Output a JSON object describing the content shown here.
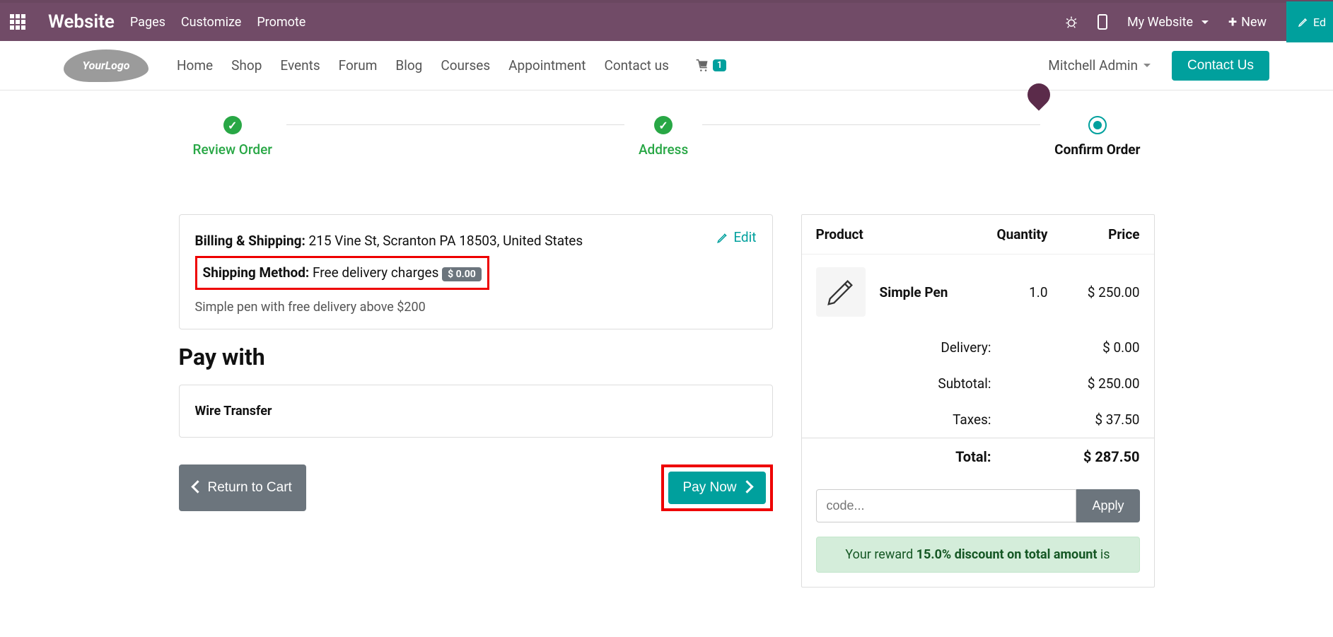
{
  "topbar": {
    "brand": "Website",
    "menu": [
      "Pages",
      "Customize",
      "Promote"
    ],
    "mywebsite": "My Website",
    "new": "New",
    "edit": "Ed"
  },
  "sitebar": {
    "logo_text": "YourLogo",
    "nav": [
      "Home",
      "Shop",
      "Events",
      "Forum",
      "Blog",
      "Courses",
      "Appointment",
      "Contact us"
    ],
    "cart_count": "1",
    "user": "Mitchell Admin",
    "contact": "Contact Us"
  },
  "steps": {
    "review": "Review Order",
    "address": "Address",
    "confirm": "Confirm Order"
  },
  "shipping_card": {
    "billing_label": "Billing & Shipping:",
    "billing_value": "215 Vine St, Scranton PA 18503, United States",
    "edit": "Edit",
    "method_label": "Shipping Method:",
    "method_value": "Free delivery charges",
    "method_price": "$ 0.00",
    "note": "Simple pen with free delivery above $200"
  },
  "pay": {
    "title": "Pay with",
    "method": "Wire Transfer",
    "return": "Return to Cart",
    "paynow": "Pay Now"
  },
  "summary": {
    "headers": {
      "product": "Product",
      "qty": "Quantity",
      "price": "Price"
    },
    "item": {
      "name": "Simple Pen",
      "qty": "1.0",
      "price": "$ 250.00"
    },
    "delivery_label": "Delivery:",
    "delivery_value": "$ 0.00",
    "subtotal_label": "Subtotal:",
    "subtotal_value": "$ 250.00",
    "taxes_label": "Taxes:",
    "taxes_value": "$ 37.50",
    "total_label": "Total:",
    "total_value": "$ 287.50",
    "promo_placeholder": "code...",
    "apply": "Apply",
    "reward_pre": "Your reward ",
    "reward_bold": "15.0% discount on total amount",
    "reward_post": " is"
  }
}
